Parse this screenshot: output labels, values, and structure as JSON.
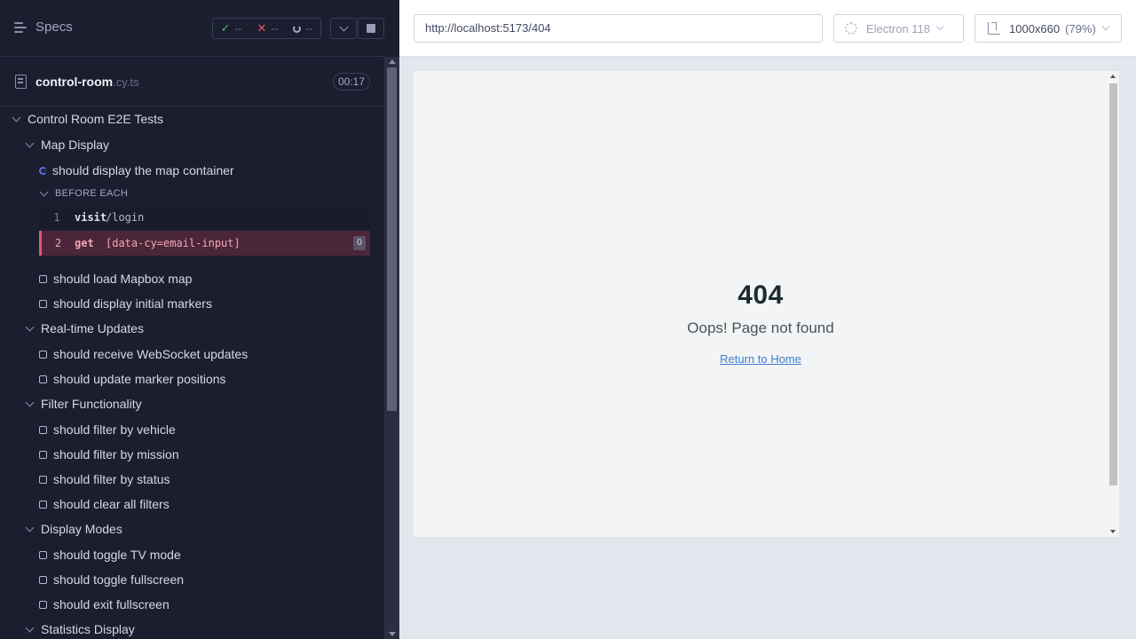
{
  "reporter": {
    "specs_label": "Specs",
    "stats": {
      "passed": "--",
      "failed": "--",
      "pending": "--"
    },
    "spec": {
      "name": "control-room",
      "ext": ".cy.ts",
      "duration": "00:17"
    },
    "tree": [
      {
        "kind": "suite",
        "label": "Control Room E2E Tests",
        "indent": 0
      },
      {
        "kind": "suite",
        "label": "Map Display",
        "indent": 1
      },
      {
        "kind": "test-running",
        "label": "should display the map container",
        "indent": 2
      },
      {
        "kind": "hook",
        "label": "BEFORE EACH",
        "indent": 3
      },
      {
        "kind": "test",
        "label": "should load Mapbox map",
        "indent": 2
      },
      {
        "kind": "test",
        "label": "should display initial markers",
        "indent": 2
      },
      {
        "kind": "suite",
        "label": "Real-time Updates",
        "indent": 1
      },
      {
        "kind": "test",
        "label": "should receive WebSocket updates",
        "indent": 2
      },
      {
        "kind": "test",
        "label": "should update marker positions",
        "indent": 2
      },
      {
        "kind": "suite",
        "label": "Filter Functionality",
        "indent": 1
      },
      {
        "kind": "test",
        "label": "should filter by vehicle",
        "indent": 2
      },
      {
        "kind": "test",
        "label": "should filter by mission",
        "indent": 2
      },
      {
        "kind": "test",
        "label": "should filter by status",
        "indent": 2
      },
      {
        "kind": "test",
        "label": "should clear all filters",
        "indent": 2
      },
      {
        "kind": "suite",
        "label": "Display Modes",
        "indent": 1
      },
      {
        "kind": "test",
        "label": "should toggle TV mode",
        "indent": 2
      },
      {
        "kind": "test",
        "label": "should toggle fullscreen",
        "indent": 2
      },
      {
        "kind": "test",
        "label": "should exit fullscreen",
        "indent": 2
      },
      {
        "kind": "suite",
        "label": "Statistics Display",
        "indent": 1
      }
    ],
    "commands": [
      {
        "num": "1",
        "name": "visit",
        "arg": "/login"
      },
      {
        "num": "2",
        "name": "get",
        "arg": "[data-cy=email-input]",
        "badge": "0"
      }
    ]
  },
  "preview": {
    "url": "http://localhost:5173/404",
    "browser": "Electron 118",
    "viewport": "1000x660",
    "scale": "(79%)",
    "page": {
      "code": "404",
      "message": "Oops! Page not found",
      "link": "Return to Home"
    }
  },
  "colors": {
    "accent": "#5c6bdf",
    "fail": "#e45770",
    "pass": "#3fbf7f",
    "link": "#3e7fd0"
  }
}
